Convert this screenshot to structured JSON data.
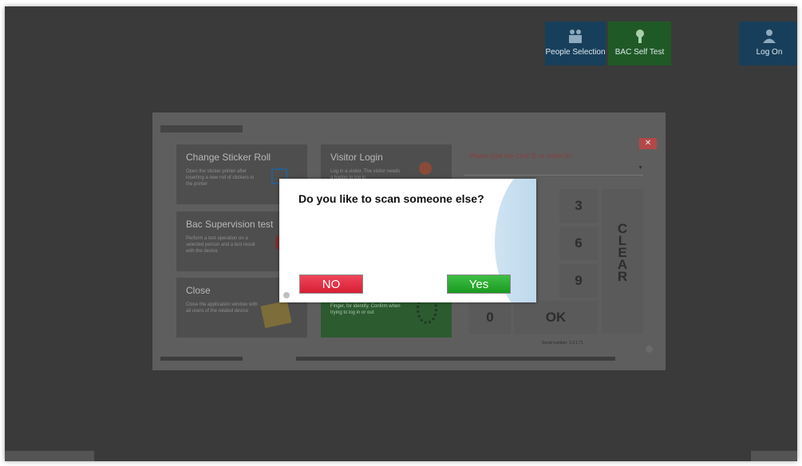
{
  "top_bar": {
    "people_selection": "People Selection",
    "bac_self_test": "BAC Self Test",
    "log_on": "Log On"
  },
  "tiles": {
    "change_sticker": {
      "title": "Change Sticker Roll",
      "desc": "Open the sticker printer after inserting a new roll of stickers in the printer"
    },
    "visitor_login": {
      "title": "Visitor Login",
      "desc": "Log in a visitor. The visitor needs a badge to log in."
    },
    "bac_supervision": {
      "title": "Bac Supervision test",
      "desc": "Perform a test operation on a selected person and a test result with the device"
    },
    "close": {
      "title": "Close",
      "desc": "Close the application window with all users of the related device"
    },
    "fingerprint": {
      "desc": "Finger, for identify. Confirm when trying to log in or out"
    }
  },
  "keypad": {
    "prompt": "Please type the Card ID or visitor ID",
    "keys": [
      "3",
      "6",
      "9",
      "0",
      "OK"
    ],
    "clear_letters": [
      "C",
      "L",
      "E",
      "A",
      "R"
    ],
    "serial": "Serial number: 1.0.1.71"
  },
  "dialog": {
    "question": "Do you like to scan someone else?",
    "no_label": "NO",
    "yes_label": "Yes"
  },
  "colors": {
    "no_button": "#d71f35",
    "yes_button": "#199a21",
    "backdrop": "#3a3a3a"
  }
}
